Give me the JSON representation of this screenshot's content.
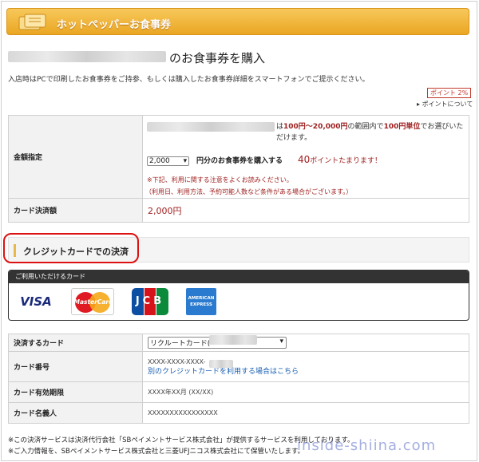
{
  "banner": {
    "title": "ホットペッパーお食事券"
  },
  "page": {
    "title_suffix": "のお食事券を購入",
    "intro": "入店時はPCで印刷したお食事券をご持参、もしくは購入したお食事券詳細をスマートフォンでご提示ください。"
  },
  "points": {
    "badge": "ポイント 2%",
    "link": "ポイントについて"
  },
  "amount": {
    "label": "金額指定",
    "range_prefix": "は",
    "range_red": "100円～20,000円",
    "range_mid": "の範囲内で",
    "unit_red": "100円単位",
    "range_suffix": "でお選びいただけます。",
    "select_value": "2,000",
    "select_caption": "円分のお食事券を購入する",
    "points_value": "40",
    "points_caption": "ポイントたまります！",
    "note1": "※下記、利用に関する注意をよくお読みください。",
    "note2": "（利用日、利用方法、予約可能人数など条件がある場合がございます。）"
  },
  "payment_amount": {
    "label": "カード決済額",
    "value": "2,000円"
  },
  "section": {
    "title": "クレジットカードでの決済"
  },
  "cards": {
    "header": "ご利用いただけるカード",
    "visa": "VISA",
    "mastercard": "MasterCard",
    "jcb": "JCB",
    "amex_top": "AMERICAN",
    "amex_bottom": "EXPRESS"
  },
  "payment_form": {
    "card_label": "決済するカード",
    "card_value": "リクルートカード(",
    "number_label": "カード番号",
    "number_value": "XXXX-XXXX-XXXX-",
    "other_card_link": "別のクレジットカードを利用する場合はこちら",
    "expiry_label": "カード有効期限",
    "expiry_value": "XXXX年XX月 (XX/XX)",
    "holder_label": "カード名義人",
    "holder_value": "XXXXXXXXXXXXXXXX"
  },
  "footer": {
    "line1": "※この決済サービスは決済代行会社「SBペイメントサービス株式会社」が提供するサービスを利用しております。",
    "line2": "※ご入力情報を、SBペイメントサービス株式会社と三菱UFJニコス株式会社にて保管いたします。"
  },
  "watermark": "inside-shiina.com",
  "colors": {
    "banner": "#eaa623",
    "accent_red": "#a02020",
    "oval": "#dd1111",
    "link": "#1a5fb4"
  }
}
